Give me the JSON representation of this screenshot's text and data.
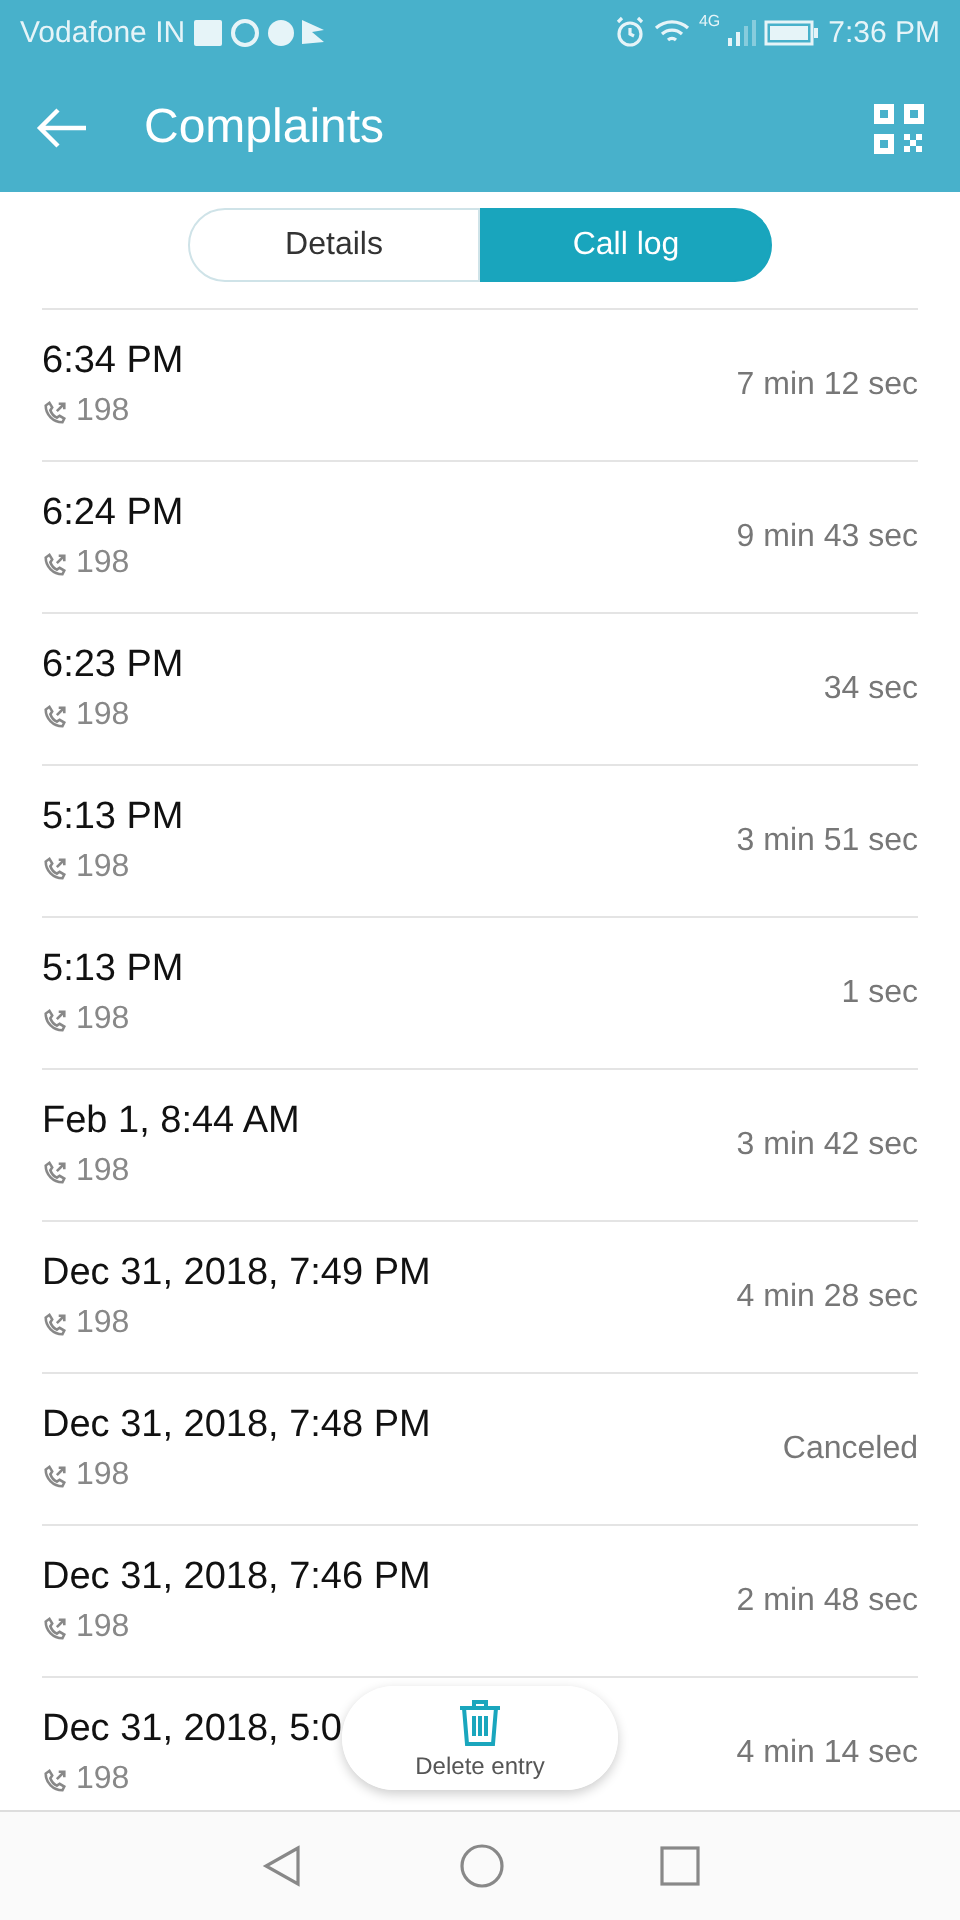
{
  "status_bar": {
    "carrier": "Vodafone IN",
    "time": "7:36 PM",
    "network": "4G"
  },
  "header": {
    "title": "Complaints"
  },
  "tabs": [
    {
      "label": "Details",
      "selected": false
    },
    {
      "label": "Call log",
      "selected": true
    }
  ],
  "calls": [
    {
      "time": "6:34 PM",
      "number": "198",
      "duration": "7 min 12 sec"
    },
    {
      "time": "6:24 PM",
      "number": "198",
      "duration": "9 min 43 sec"
    },
    {
      "time": "6:23 PM",
      "number": "198",
      "duration": "34 sec"
    },
    {
      "time": "5:13 PM",
      "number": "198",
      "duration": "3 min 51 sec"
    },
    {
      "time": "5:13 PM",
      "number": "198",
      "duration": "1 sec"
    },
    {
      "time": "Feb 1, 8:44 AM",
      "number": "198",
      "duration": "3 min 42 sec"
    },
    {
      "time": "Dec 31, 2018, 7:49 PM",
      "number": "198",
      "duration": "4 min 28 sec"
    },
    {
      "time": "Dec 31, 2018, 7:48 PM",
      "number": "198",
      "duration": "Canceled"
    },
    {
      "time": "Dec 31, 2018, 7:46 PM",
      "number": "198",
      "duration": "2 min 48 sec"
    },
    {
      "time": "Dec 31, 2018, 5:0",
      "number": "198",
      "duration": "4 min 14 sec"
    }
  ],
  "floating_action": {
    "label": "Delete entry"
  }
}
